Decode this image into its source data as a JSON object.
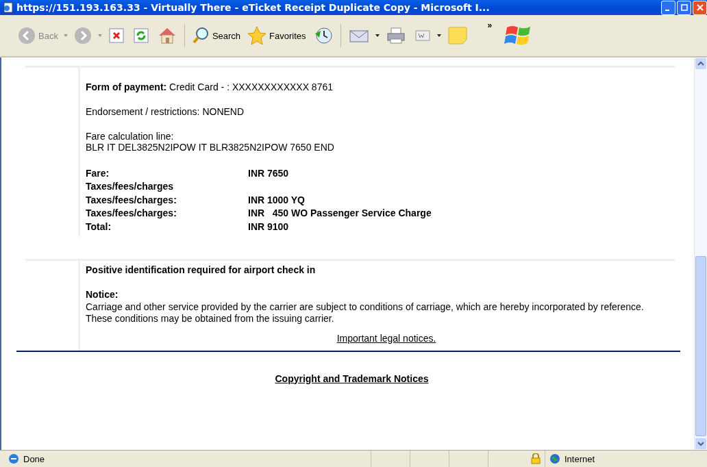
{
  "window": {
    "title": "https://151.193.163.33 - Virtually There - eTicket Receipt Duplicate Copy - Microsoft I..."
  },
  "toolbar": {
    "back": {
      "label": "Back",
      "disabled": true
    },
    "search": "Search",
    "favorites": "Favorites",
    "chevron": "»"
  },
  "payment": {
    "label": "Form of payment:",
    "value": "Credit Card - :  XXXXXXXXXXXX 8761"
  },
  "endorsement": "Endorsement / restrictions: NONEND",
  "fare_calculation": {
    "label": "Fare calculation line:",
    "value": "BLR IT DEL3825N2IPOW IT BLR3825N2IPOW 7650 END"
  },
  "fare_rows": [
    {
      "label": "Fare:",
      "value": "INR 7650"
    },
    {
      "label": "Taxes/fees/charges"
    },
    {
      "label": "Taxes/fees/charges:",
      "value": "INR 1000 YQ"
    },
    {
      "label": "Taxes/fees/charges:",
      "value": "INR   450 WO Passenger Service Charge"
    },
    {
      "label": "Total:",
      "value": "INR 9100"
    }
  ],
  "identification": "Positive identification required for airport check in",
  "notice": {
    "title": "Notice:",
    "text": "Carriage and other service provided by the carrier are subject to conditions of carriage, which are hereby incorporated by reference. These conditions may be obtained from the issuing carrier."
  },
  "legal_link": "Important legal notices.",
  "copyright_link": "Copyright and Trademark Notices",
  "status_bar": {
    "status": "Done",
    "zone": "Internet"
  }
}
